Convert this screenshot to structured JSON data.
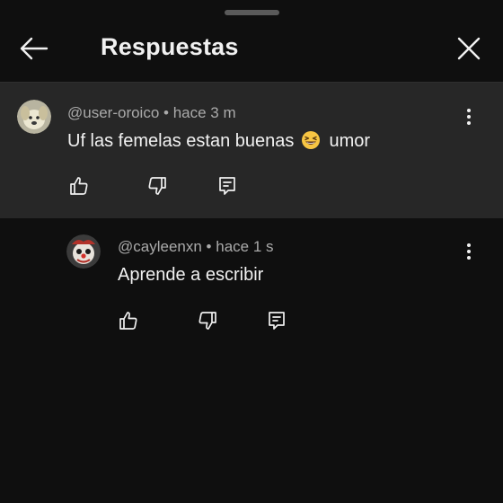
{
  "header": {
    "title": "Respuestas",
    "back_icon": "arrow-left-icon",
    "close_icon": "close-icon"
  },
  "comments": [
    {
      "author": "@user-oroico",
      "time": "hace 3 m",
      "text_before_emoji": "Uf las femelas estan buenas",
      "emoji": "grinning-squinting-face",
      "text_after_emoji": "umor",
      "avatar_icon": "dog-avatar",
      "actions": [
        "like-icon",
        "dislike-icon",
        "reply-icon"
      ]
    },
    {
      "author": "@cayleenxn",
      "time": "hace 1 s",
      "text": "Aprende a escribir",
      "avatar_icon": "clown-avatar",
      "actions": [
        "like-icon",
        "dislike-icon",
        "reply-icon"
      ]
    }
  ],
  "colors": {
    "background": "#0f0f0f",
    "highlight_background": "#272727",
    "primary_text": "#f1f1f1",
    "secondary_text": "#aaaaaa"
  }
}
